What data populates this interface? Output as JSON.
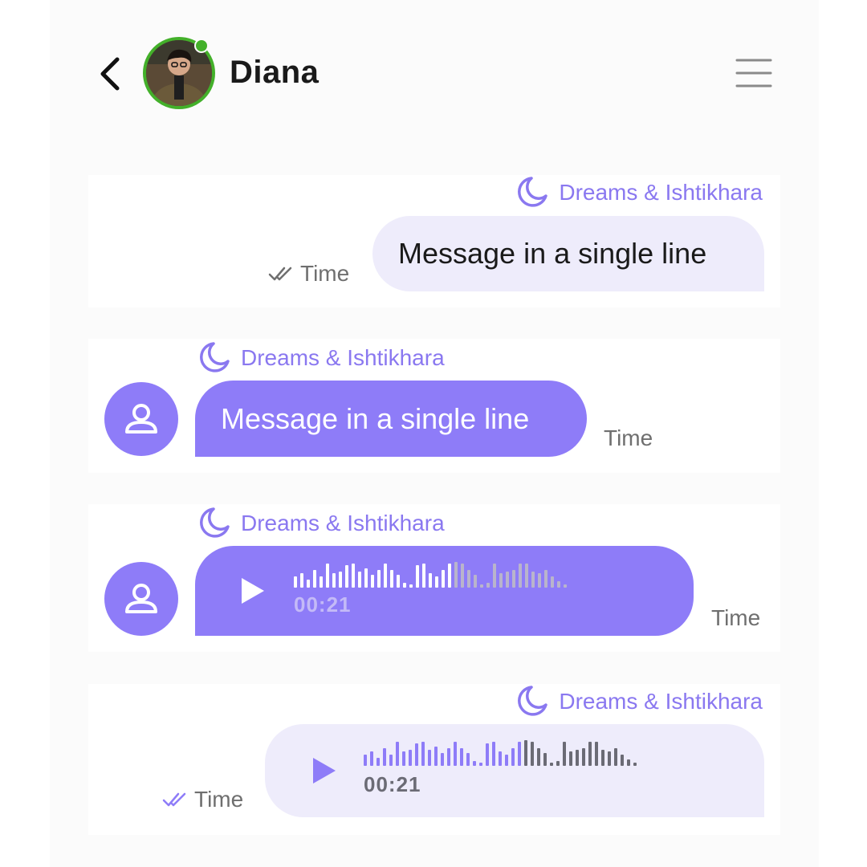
{
  "header": {
    "contact_name": "Diana",
    "online": true,
    "icons": {
      "back": "chevron-left-icon",
      "menu": "hamburger-menu-icon"
    }
  },
  "messages": [
    {
      "direction": "outgoing",
      "type": "text",
      "tag": "Dreams & Ishtikhara",
      "text": "Message in a single line",
      "time": "Time",
      "read": true
    },
    {
      "direction": "incoming",
      "type": "text",
      "tag": "Dreams & Ishtikhara",
      "text": "Message in a single line",
      "time": "Time"
    },
    {
      "direction": "incoming",
      "type": "voice",
      "tag": "Dreams & Ishtikhara",
      "duration": "00:21",
      "time": "Time",
      "played_fraction": 0.57
    },
    {
      "direction": "outgoing",
      "type": "voice",
      "tag": "Dreams & Ishtikhara",
      "duration": "00:21",
      "time": "Time",
      "read": true,
      "played_fraction": 0.57
    }
  ],
  "colors": {
    "accent": "#8e7cf8",
    "accent_text": "#8a78f0",
    "outgoing_bubble": "#eeecfb",
    "online": "#43b02a",
    "wave_unplayed_light": "#b9b4cc",
    "wave_unplayed_dark": "#6b6b75"
  }
}
